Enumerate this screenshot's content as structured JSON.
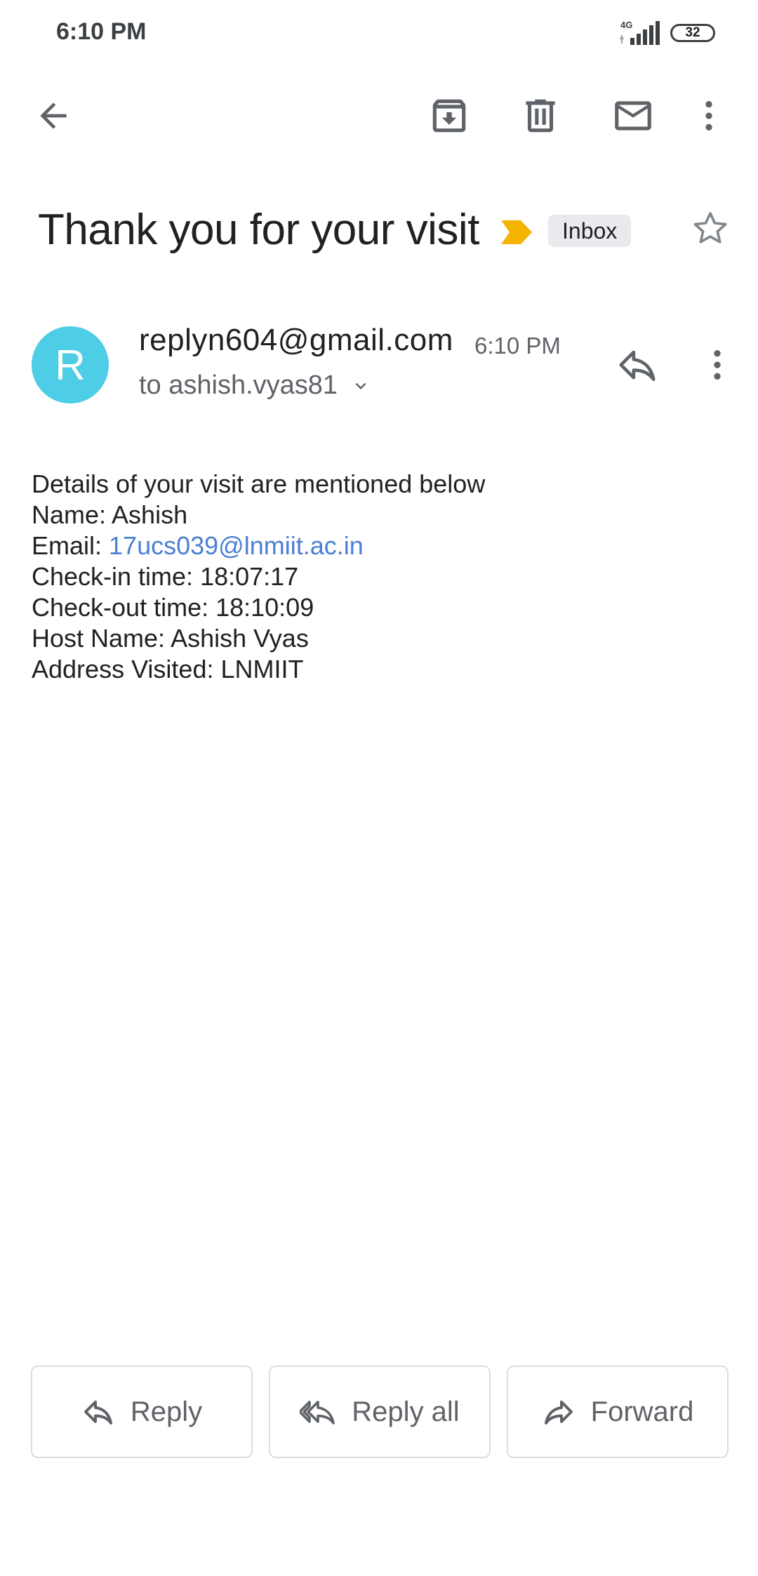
{
  "status_bar": {
    "time": "6:10 PM",
    "network": "4G",
    "battery": "32"
  },
  "toolbar": {
    "icons": [
      "back-arrow-icon",
      "archive-icon",
      "delete-icon",
      "mail-icon",
      "more-vert-icon"
    ]
  },
  "email": {
    "subject": "Thank you for your visit",
    "label": "Inbox",
    "sender": {
      "initial": "R",
      "address": "replyn604@gmail.com",
      "time": "6:10 PM",
      "recipient": "to ashish.vyas81"
    },
    "body": {
      "intro": "Details of your visit are mentioned below",
      "name": "Name: Ashish",
      "email_prefix": "Email: ",
      "email_link": "17ucs039@lnmiit.ac.in",
      "checkin": "Check-in time: 18:07:17",
      "checkout": "Check-out time: 18:10:09",
      "host": "Host Name: Ashish Vyas",
      "address": "Address Visited: LNMIIT"
    }
  },
  "actions": {
    "reply": "Reply",
    "reply_all": "Reply all",
    "forward": "Forward"
  },
  "colors": {
    "avatar": "#4ecde6",
    "importance": "#f4b400",
    "link": "#4a7fd4",
    "icon": "#5f6368"
  }
}
